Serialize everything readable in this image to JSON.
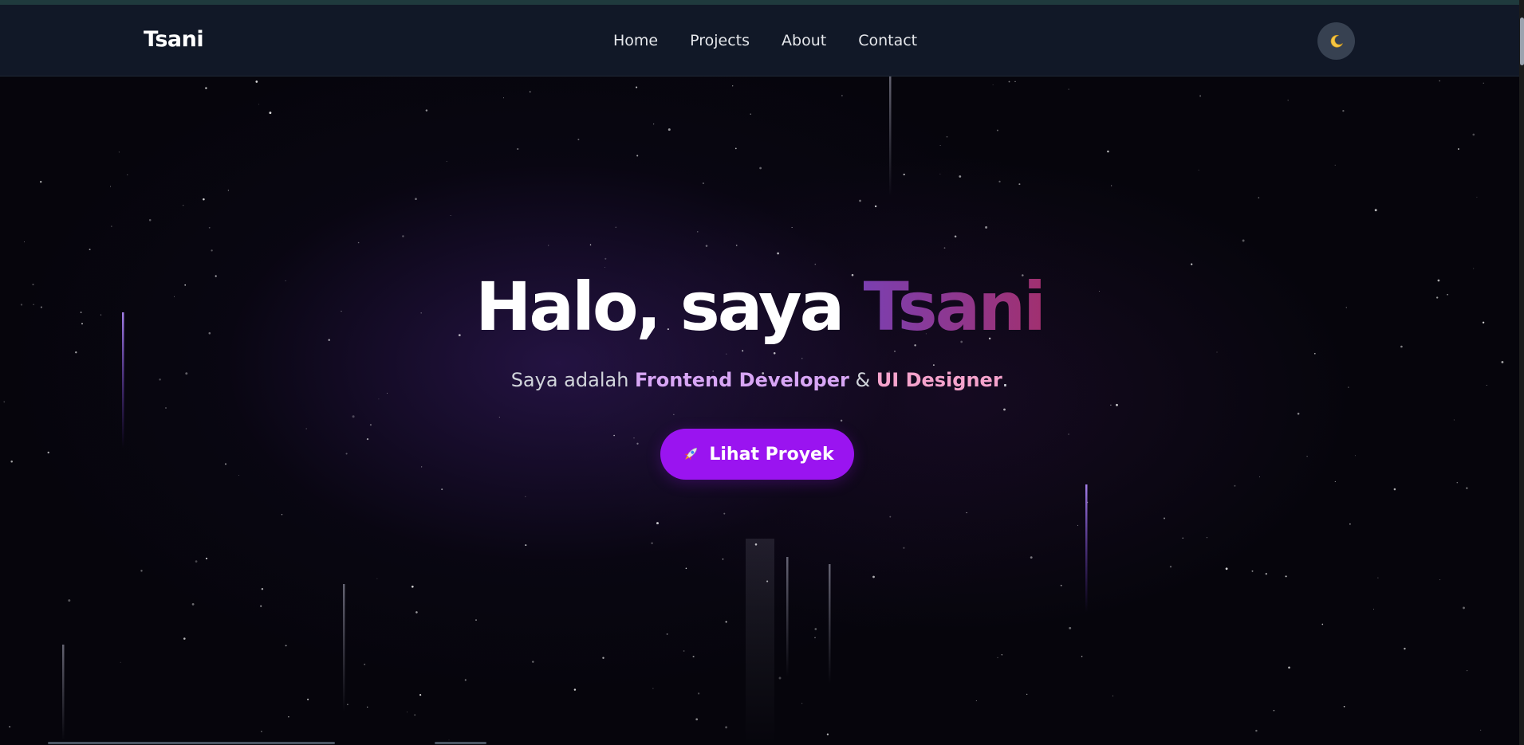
{
  "navbar": {
    "brand": "Tsani",
    "links": [
      "Home",
      "Projects",
      "About",
      "Contact"
    ],
    "theme_toggle_icon": "moon-icon"
  },
  "hero": {
    "title_prefix": "Halo, saya ",
    "title_name": "Tsani",
    "subtitle_prefix": "Saya adalah ",
    "subtitle_role1": "Frontend Developer",
    "subtitle_amp": " & ",
    "subtitle_role2": "UI Designer",
    "subtitle_suffix": ".",
    "cta_icon": "rocket-icon",
    "cta_label": "Lihat Proyek"
  },
  "colors": {
    "navbar_bg": "#111827",
    "accent": "#9a14f0",
    "highlight_purple": "#d8a6f5",
    "highlight_pink": "#f5a3cc"
  }
}
